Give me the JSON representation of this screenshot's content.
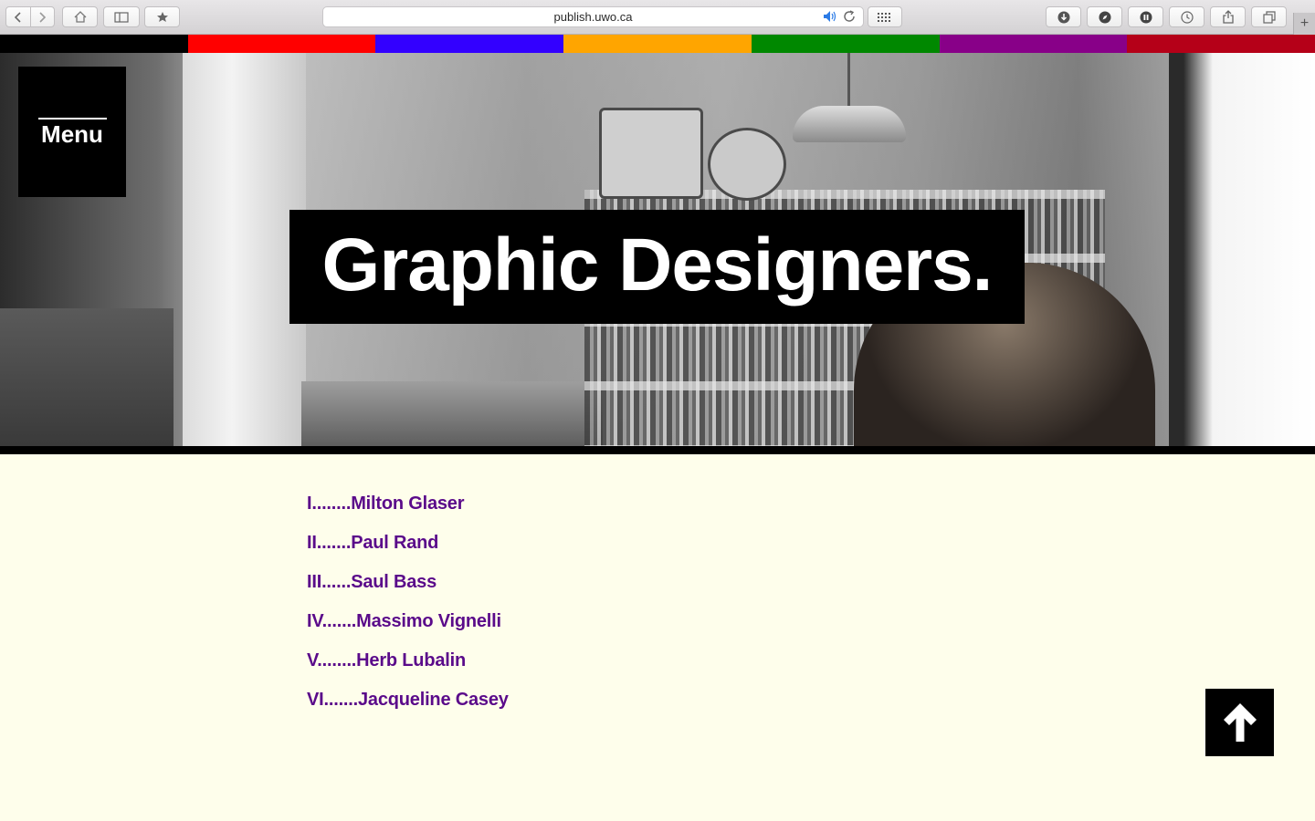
{
  "browser": {
    "url": "publish.uwo.ca",
    "new_tab_label": "+",
    "icons": {
      "back": "chevron-left-icon",
      "forward": "chevron-right-icon",
      "home": "home-icon",
      "sidebar": "sidebar-icon",
      "bookmarks": "star-icon",
      "audio": "speaker-icon",
      "reload": "reload-icon",
      "top_sites": "grid-icon",
      "downloads": "download-icon",
      "ext1": "compass-icon",
      "ext2": "pause-icon",
      "history": "clock-icon",
      "share": "share-icon",
      "tabs": "tabs-icon"
    }
  },
  "stripe_colors": [
    "#000000",
    "#ff0000",
    "#3300ff",
    "#ffa500",
    "#008800",
    "#880088",
    "#b50018"
  ],
  "menu": {
    "label": "Menu"
  },
  "hero": {
    "title": "Graphic Designers."
  },
  "designers": [
    {
      "label": "I........Milton Glaser"
    },
    {
      "label": "II.......Paul Rand"
    },
    {
      "label": "III......Saul Bass"
    },
    {
      "label": "IV.......Massimo Vignelli"
    },
    {
      "label": "V........Herb Lubalin"
    },
    {
      "label": "VI.......Jacqueline Casey"
    }
  ],
  "back_to_top": {
    "icon": "arrow-up-icon"
  },
  "colors": {
    "page_background": "#fefeeb",
    "link": "#5a0a8a",
    "box": "#000000"
  }
}
